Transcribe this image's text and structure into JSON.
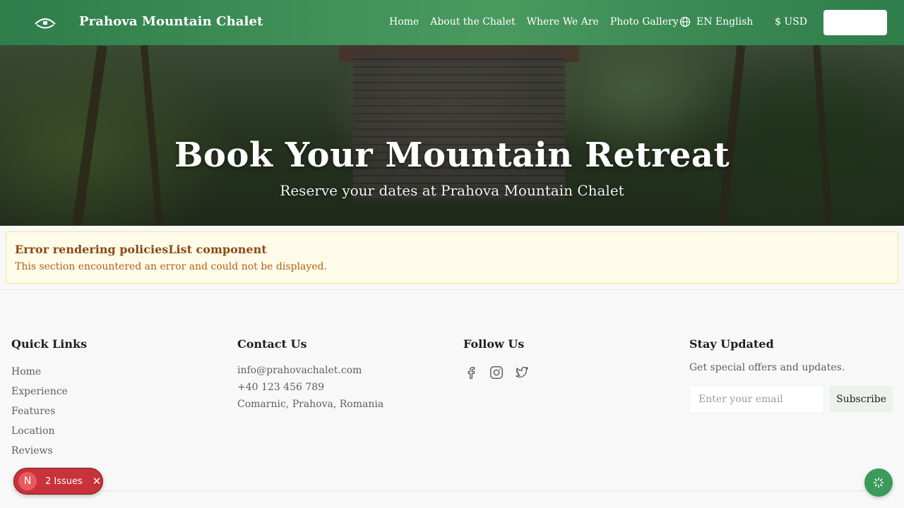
{
  "header": {
    "brand": "Prahova Mountain Chalet",
    "nav": [
      {
        "label": "Home"
      },
      {
        "label": "About the Chalet"
      },
      {
        "label": "Where We Are"
      },
      {
        "label": "Photo Gallery"
      }
    ],
    "language": "EN English",
    "currency": "$ USD",
    "accent_color": "#3f9158"
  },
  "hero": {
    "title": "Book Your Mountain Retreat",
    "subtitle": "Reserve your dates at Prahova Mountain Chalet"
  },
  "error": {
    "title": "Error rendering policiesList component",
    "message": "This section encountered an error and could not be displayed."
  },
  "footer": {
    "quick_links": {
      "heading": "Quick Links",
      "items": [
        "Home",
        "Experience",
        "Features",
        "Location",
        "Reviews"
      ]
    },
    "contact": {
      "heading": "Contact Us",
      "email": "info@prahovachalet.com",
      "phone": "+40 123 456 789",
      "address": "Comarnic, Prahova, Romania"
    },
    "follow": {
      "heading": "Follow Us",
      "icons": [
        "facebook-icon",
        "instagram-icon",
        "twitter-icon"
      ]
    },
    "stay_updated": {
      "heading": "Stay Updated",
      "text": "Get special offers and updates.",
      "email_placeholder": "Enter your email",
      "subscribe_label": "Subscribe"
    }
  },
  "dev_overlay": {
    "badge_letter": "N",
    "issues_label": "2 Issues",
    "close": "✕"
  }
}
